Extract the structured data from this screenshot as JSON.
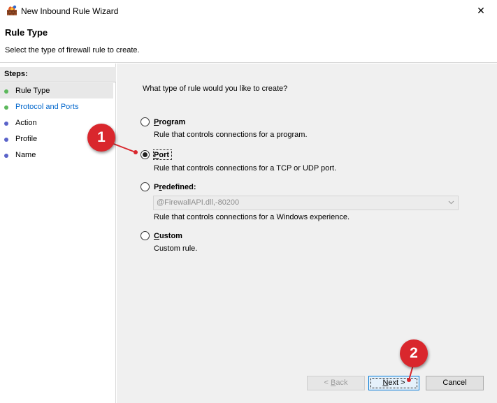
{
  "window": {
    "title": "New Inbound Rule Wizard",
    "close_glyph": "✕"
  },
  "header": {
    "title": "Rule Type",
    "subtitle": "Select the type of firewall rule to create."
  },
  "steps": {
    "label": "Steps:",
    "items": [
      {
        "label": "Rule Type",
        "state": "current",
        "dot_color": "#5cb85c"
      },
      {
        "label": "Protocol and Ports",
        "state": "link",
        "dot_color": "#5cb85c"
      },
      {
        "label": "Action",
        "state": "normal",
        "dot_color": "#5a63c9"
      },
      {
        "label": "Profile",
        "state": "normal",
        "dot_color": "#5a63c9"
      },
      {
        "label": "Name",
        "state": "normal",
        "dot_color": "#5a63c9"
      }
    ],
    "link_color": "#0066cc"
  },
  "main": {
    "question": "What type of rule would you like to create?",
    "options": [
      {
        "underline": "P",
        "rest": "rogram",
        "description": "Rule that controls connections for a program.",
        "checked": false
      },
      {
        "underline": "P",
        "rest": "ort",
        "description": "Rule that controls connections for a TCP or UDP port.",
        "checked": true
      },
      {
        "before": "P",
        "underline": "r",
        "rest": "edefined:",
        "description": "Rule that controls connections for a Windows experience.",
        "checked": false
      },
      {
        "underline": "C",
        "rest": "ustom",
        "description": "Custom rule.",
        "checked": false
      }
    ],
    "predefined_dropdown": {
      "value": "@FirewallAPI.dll,-80200",
      "enabled": false
    }
  },
  "buttons": {
    "back": {
      "prefix": "< ",
      "underline": "B",
      "rest": "ack",
      "enabled": false
    },
    "next": {
      "underline": "N",
      "rest": "ext >",
      "enabled": true
    },
    "cancel": {
      "label": "Cancel"
    }
  },
  "callouts": [
    {
      "number": "1",
      "color": "#d9272d"
    },
    {
      "number": "2",
      "color": "#d9272d"
    }
  ]
}
